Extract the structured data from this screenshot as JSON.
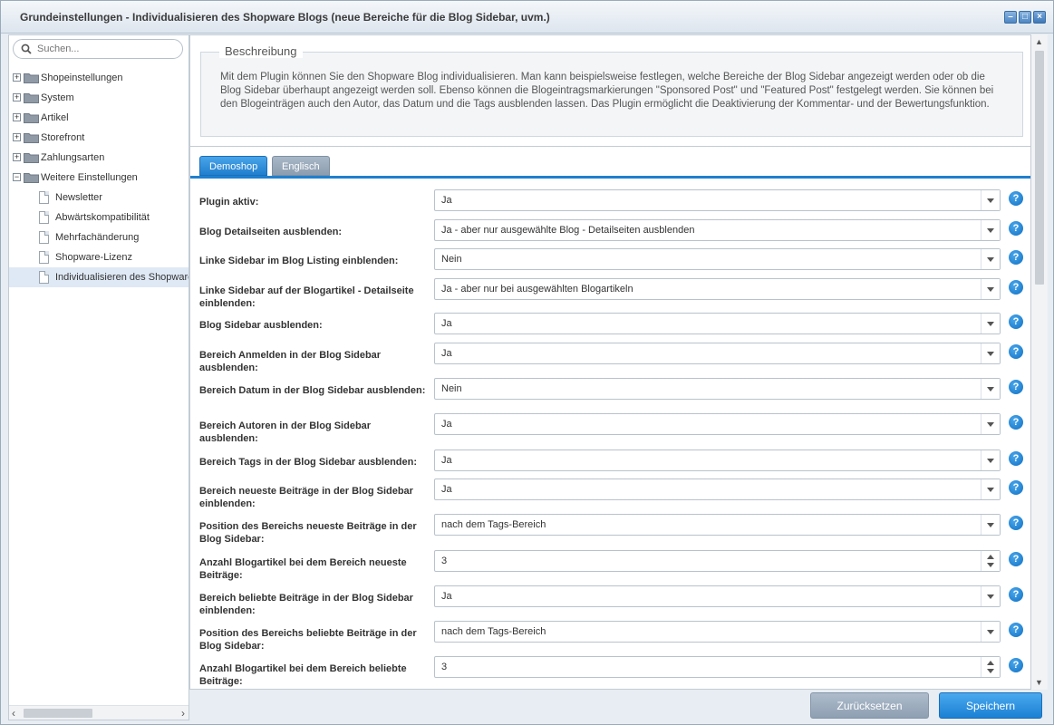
{
  "window": {
    "title": "Grundeinstellungen - Individualisieren des Shopware Blogs (neue Bereiche für die Blog Sidebar, uvm.)"
  },
  "search": {
    "placeholder": "Suchen..."
  },
  "tree": {
    "items": [
      {
        "label": "Shopeinstellungen",
        "type": "folder"
      },
      {
        "label": "System",
        "type": "folder"
      },
      {
        "label": "Artikel",
        "type": "folder"
      },
      {
        "label": "Storefront",
        "type": "folder"
      },
      {
        "label": "Zahlungsarten",
        "type": "folder"
      },
      {
        "label": "Weitere Einstellungen",
        "type": "folder-open"
      },
      {
        "label": "Newsletter",
        "type": "doc"
      },
      {
        "label": "Abwärtskompatibilität",
        "type": "doc"
      },
      {
        "label": "Mehrfachänderung",
        "type": "doc"
      },
      {
        "label": "Shopware-Lizenz",
        "type": "doc"
      },
      {
        "label": "Individualisieren des Shopware",
        "type": "doc",
        "selected": true
      }
    ]
  },
  "description": {
    "legend": "Beschreibung",
    "text": "Mit dem Plugin können Sie den Shopware Blog individualisieren. Man kann beispielsweise festlegen, welche Bereiche der Blog Sidebar angezeigt werden oder ob die Blog Sidebar überhaupt angezeigt werden soll. Ebenso können die Blogeintragsmarkierungen \"Sponsored Post\" und \"Featured Post\" festgelegt werden. Sie können bei den Blogeinträgen auch den Autor, das Datum und die Tags ausblenden lassen. Das Plugin ermöglicht die Deaktivierung der Kommentar- und der Bewertungsfunktion."
  },
  "tabs": [
    {
      "label": "Demoshop",
      "active": true
    },
    {
      "label": "Englisch",
      "active": false
    }
  ],
  "form": {
    "fields": [
      {
        "label": "Plugin aktiv:",
        "value": "Ja",
        "kind": "combo"
      },
      {
        "label": "Blog Detailseiten ausblenden:",
        "value": "Ja - aber nur ausgewählte Blog - Detailseiten ausblenden",
        "kind": "combo"
      },
      {
        "label": "Linke Sidebar im Blog Listing einblenden:",
        "value": "Nein",
        "kind": "combo"
      },
      {
        "label": "Linke Sidebar auf der Blogartikel - Detailseite einblenden:",
        "value": "Ja - aber nur bei ausgewählten Blogartikeln",
        "kind": "combo"
      },
      {
        "label": "Blog Sidebar ausblenden:",
        "value": "Ja",
        "kind": "combo"
      },
      {
        "label": "Bereich Anmelden in der Blog Sidebar ausblenden:",
        "value": "Ja",
        "kind": "combo"
      },
      {
        "label": "Bereich Datum in der Blog Sidebar ausblenden:",
        "value": "Nein",
        "kind": "combo"
      },
      {
        "label": "Bereich Autoren in der Blog Sidebar ausblenden:",
        "value": "Ja",
        "kind": "combo"
      },
      {
        "label": "Bereich Tags in der Blog Sidebar ausblenden:",
        "value": "Ja",
        "kind": "combo"
      },
      {
        "label": "Bereich neueste Beiträge in der Blog Sidebar einblenden:",
        "value": "Ja",
        "kind": "combo"
      },
      {
        "label": "Position des Bereichs neueste Beiträge in der Blog Sidebar:",
        "value": "nach dem Tags-Bereich",
        "kind": "combo"
      },
      {
        "label": "Anzahl Blogartikel bei dem Bereich neueste Beiträge:",
        "value": "3",
        "kind": "spin"
      },
      {
        "label": "Bereich beliebte Beiträge in der Blog Sidebar einblenden:",
        "value": "Ja",
        "kind": "combo"
      },
      {
        "label": "Position des Bereichs beliebte Beiträge in der Blog Sidebar:",
        "value": "nach dem Tags-Bereich",
        "kind": "combo"
      },
      {
        "label": "Anzahl Blogartikel bei dem Bereich beliebte Beiträge:",
        "value": "3",
        "kind": "spin"
      }
    ],
    "help_symbol": "?"
  },
  "footer": {
    "reset_label": "Zurücksetzen",
    "save_label": "Speichern"
  },
  "colors": {
    "accent": "#1f7fcf",
    "reset": "#9aaabb"
  }
}
